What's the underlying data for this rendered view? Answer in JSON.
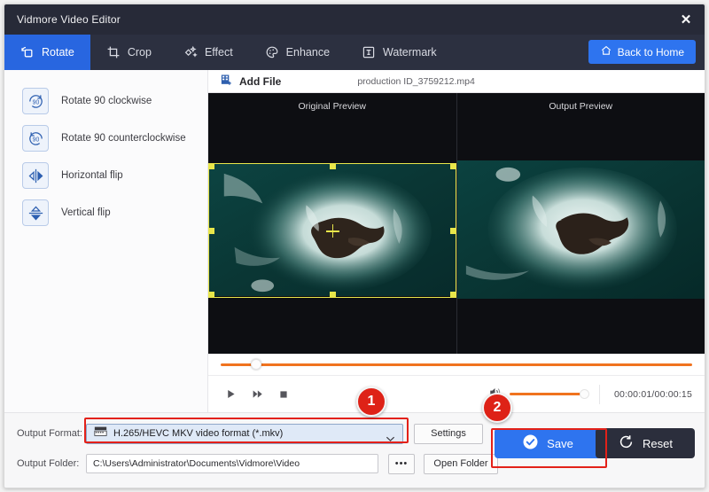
{
  "window": {
    "title": "Vidmore Video Editor",
    "close_icon": "close-icon"
  },
  "tabs": [
    {
      "label": "Rotate",
      "icon": "rotate-icon",
      "active": true
    },
    {
      "label": "Crop",
      "icon": "crop-icon",
      "active": false
    },
    {
      "label": "Effect",
      "icon": "effect-icon",
      "active": false
    },
    {
      "label": "Enhance",
      "icon": "enhance-icon",
      "active": false
    },
    {
      "label": "Watermark",
      "icon": "watermark-icon",
      "active": false
    }
  ],
  "header": {
    "back_home_label": "Back to Home",
    "back_home_icon": "home-icon"
  },
  "sidebar": {
    "items": [
      {
        "label": "Rotate 90 clockwise",
        "icon": "rotate-cw-90-icon"
      },
      {
        "label": "Rotate 90 counterclockwise",
        "icon": "rotate-ccw-90-icon"
      },
      {
        "label": "Horizontal flip",
        "icon": "horizontal-flip-icon"
      },
      {
        "label": "Vertical flip",
        "icon": "vertical-flip-icon"
      }
    ]
  },
  "preview": {
    "add_file_label": "Add File",
    "add_file_icon": "add-file-icon",
    "filename": "production ID_3759212.mp4",
    "original_label": "Original Preview",
    "output_label": "Output Preview"
  },
  "transport": {
    "play_icon": "play-icon",
    "forward_icon": "fast-forward-icon",
    "stop_icon": "stop-icon",
    "volume_icon": "volume-icon",
    "time": "00:00:01/00:00:15"
  },
  "footer": {
    "output_format_label": "Output Format:",
    "output_format_value": "H.265/HEVC MKV video format (*.mkv)",
    "format_icon": "film-format-icon",
    "chevron_icon": "chevron-down-icon",
    "settings_label": "Settings",
    "output_folder_label": "Output Folder:",
    "output_folder_value": "C:\\Users\\Administrator\\Documents\\Vidmore\\Video",
    "browse_label": "•••",
    "open_folder_label": "Open Folder",
    "save_label": "Save",
    "save_icon": "check-circle-icon",
    "reset_label": "Reset",
    "reset_icon": "reset-arrow-icon"
  },
  "annotations": {
    "badge_one": "1",
    "badge_two": "2",
    "highlight_color": "#e32119"
  }
}
